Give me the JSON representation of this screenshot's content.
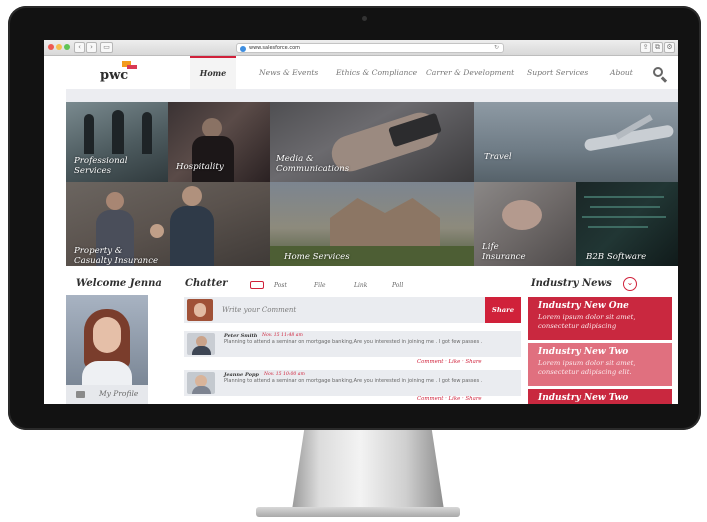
{
  "browser": {
    "url": "www.salesforce.com",
    "colors": {
      "close": "#ee5a52",
      "minimize": "#f5bf4f",
      "maximize": "#60c454"
    }
  },
  "header": {
    "logo_text": "pwc",
    "nav": [
      {
        "label": "Home",
        "active": true
      },
      {
        "label": "News & Events"
      },
      {
        "label": "Ethics & Compliance"
      },
      {
        "label": "Carrer & Development"
      },
      {
        "label": "Suport Services"
      },
      {
        "label": "About"
      }
    ],
    "search_icon": "search-icon"
  },
  "tiles": [
    {
      "label_lines": [
        "Professional",
        "Services"
      ]
    },
    {
      "label_lines": [
        "Hospitality"
      ]
    },
    {
      "label_lines": [
        "Media &",
        "Communications"
      ]
    },
    {
      "label_lines": [
        "Travel"
      ]
    },
    {
      "label_lines": [
        "Property &",
        "Casualty Insurance"
      ]
    },
    {
      "label_lines": [
        "Home Services"
      ]
    },
    {
      "label_lines": [
        "Life",
        "Insurance"
      ]
    },
    {
      "label_lines": [
        "B2B Software"
      ]
    }
  ],
  "welcome": {
    "title": "Welcome Jenna",
    "profile_label": "My Profile"
  },
  "chatter": {
    "title": "Chatter",
    "tabs": [
      "Post",
      "File",
      "Link",
      "Poll"
    ],
    "comment_placeholder": "Write your Comment",
    "share_label": "Share",
    "posts": [
      {
        "name": "Peter Smith",
        "time": "Nov. 15 11:48 am",
        "text": "Planning to attend a seminar on mortgage banking,Are you interested in joining me . I got few passes .",
        "actions": "Comment  ·  Like  ·  Share"
      },
      {
        "name": "Jeanne Popp",
        "time": "Nov. 15 10:00 am",
        "text": "Planning to attend a seminar on mortgage banking,Are you interested in joining me . I got few passes .",
        "actions": "Comment  ·  Like  ·  Share"
      }
    ]
  },
  "industry_news": {
    "title": "Industry News",
    "toggle_icon": "chevron-down-icon",
    "accent": "#d0213a",
    "items": [
      {
        "title": "Industry New One",
        "text": "Lorem ipsum dolor sit amet, consectetur adipiscing"
      },
      {
        "title": "Industry New Two",
        "text": "Lorem ipsum dolor sit amet, consectetur adipiscing elit."
      },
      {
        "title": "Industry New Two",
        "text": ""
      }
    ]
  }
}
